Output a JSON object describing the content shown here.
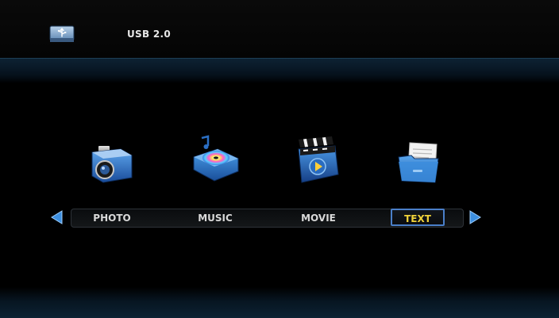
{
  "header": {
    "device_label": "USB 2.0",
    "device_icon": "usb-drive-icon"
  },
  "menu": {
    "items": [
      {
        "label": "PHOTO",
        "icon": "camera-icon"
      },
      {
        "label": "MUSIC",
        "icon": "music-disc-icon"
      },
      {
        "label": "MOVIE",
        "icon": "clapperboard-icon"
      },
      {
        "label": "TEXT",
        "icon": "folder-document-icon"
      }
    ],
    "selected_label": "TEXT"
  },
  "colors": {
    "selected_text": "#f0d23a",
    "selection_border": "#4a7fc9",
    "arrow": "#3d8fe0"
  }
}
